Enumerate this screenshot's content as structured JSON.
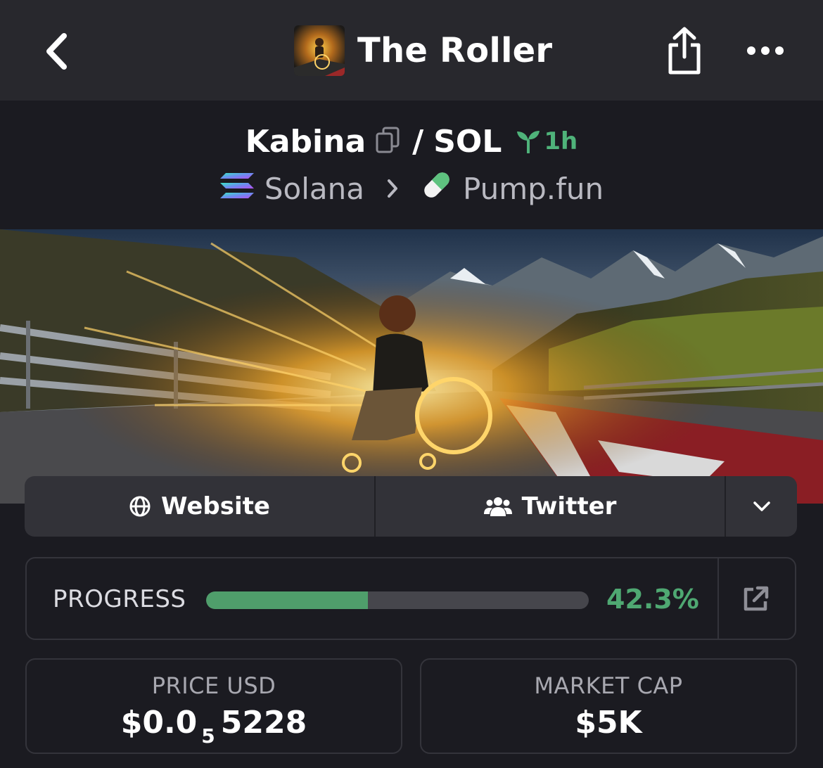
{
  "header": {
    "title": "The Roller",
    "back_icon": "chevron-left-icon",
    "share_icon": "share-icon",
    "more_icon": "more-horizontal-icon"
  },
  "pair": {
    "base": "Kabina",
    "separator": "/",
    "quote": "SOL",
    "age": "1h",
    "age_icon": "seedling-icon",
    "copy_icon": "copy-icon"
  },
  "chain": {
    "network": "Solana",
    "dex": "Pump.fun",
    "network_icon": "solana-icon",
    "dex_icon": "pill-icon"
  },
  "links": {
    "website": "Website",
    "twitter": "Twitter",
    "expand_icon": "chevron-down-icon"
  },
  "progress": {
    "label": "PROGRESS",
    "value_text": "42.3%",
    "value": 42.3,
    "link_icon": "external-link-icon"
  },
  "stats": {
    "price": {
      "label": "PRICE USD",
      "prefix": "$0.0",
      "zeros": "5",
      "suffix": "5228"
    },
    "market_cap": {
      "label": "MARKET CAP",
      "value": "$5K"
    }
  },
  "colors": {
    "accent_green": "#4fa872",
    "background": "#1b1b21",
    "topbar": "#28282d"
  }
}
